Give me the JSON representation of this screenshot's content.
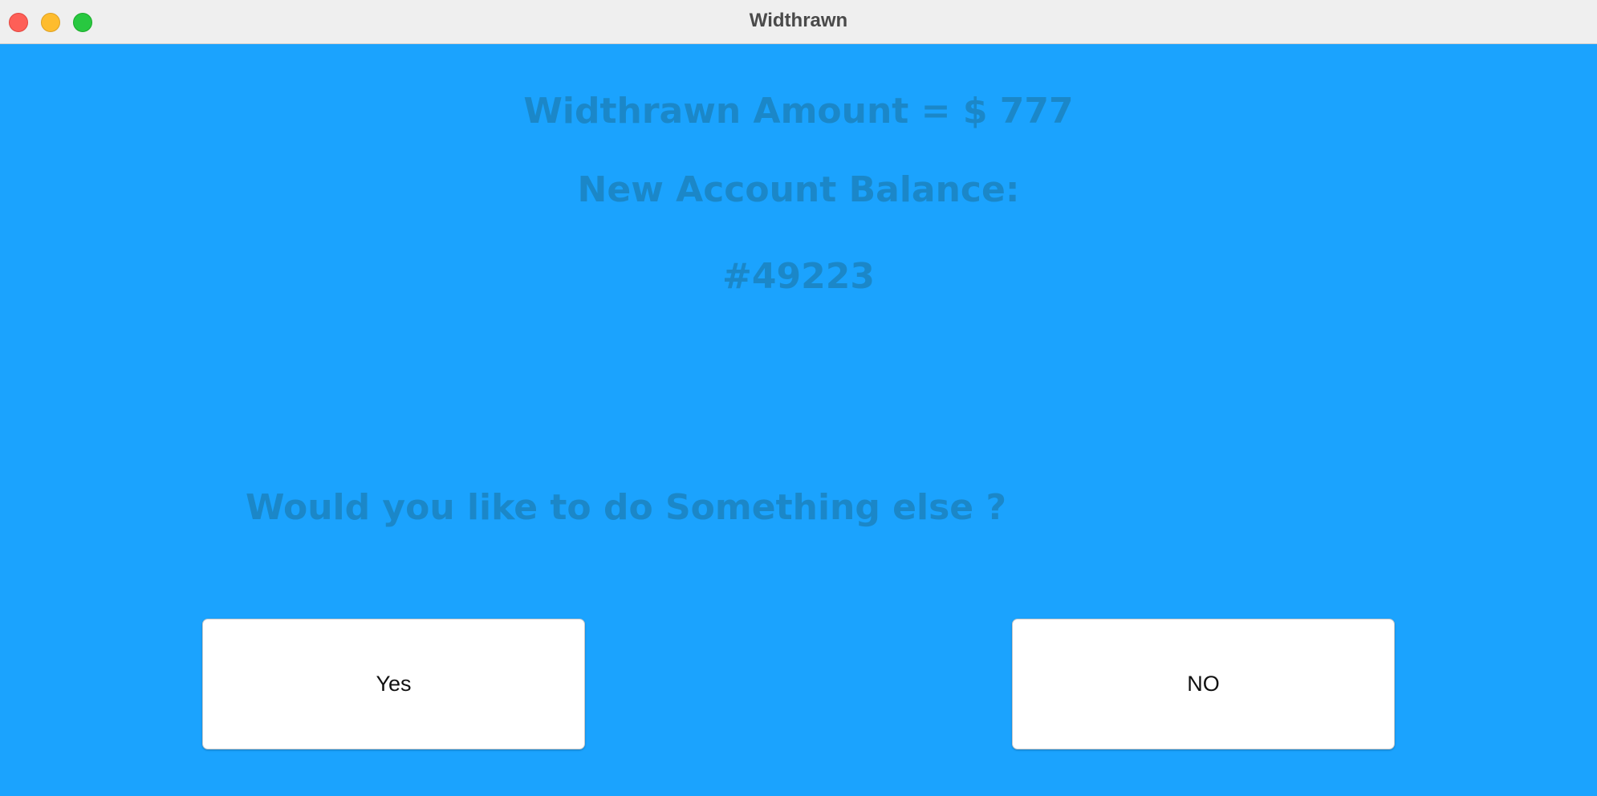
{
  "window": {
    "title": "Widthrawn"
  },
  "main": {
    "amount_line": "Widthrawn Amount = $ 777",
    "balance_label": "New Account Balance:",
    "balance_value": "#49223",
    "question": "Would you like to do Something else ?"
  },
  "buttons": {
    "yes_label": "Yes",
    "no_label": "NO"
  },
  "colors": {
    "background": "#1ba3fe",
    "heading_text": "#1b87c8",
    "button_background": "#ffffff"
  }
}
